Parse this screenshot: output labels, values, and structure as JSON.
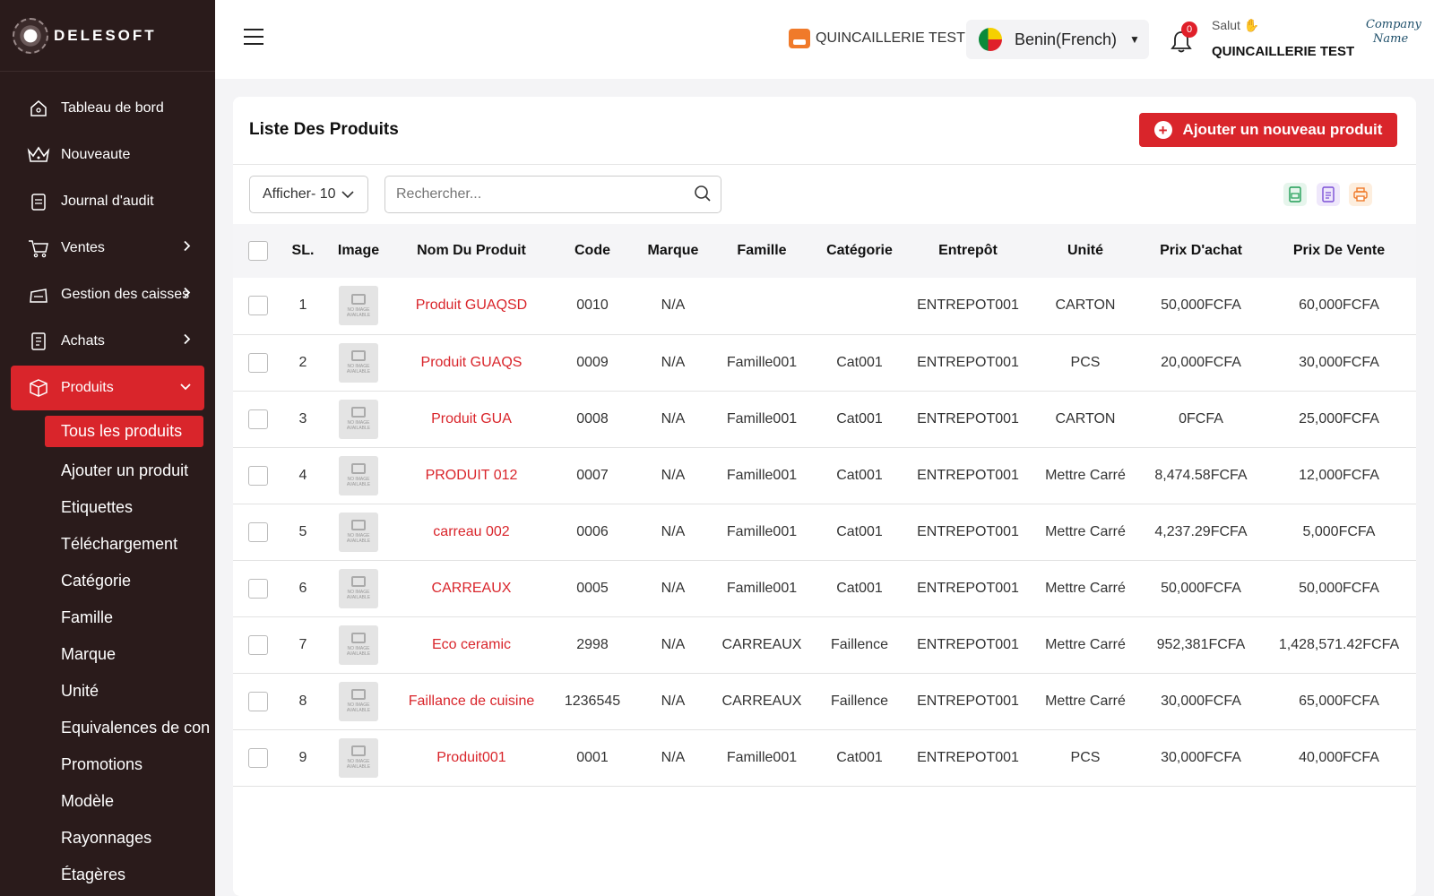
{
  "brand": {
    "name": "DELESOFT"
  },
  "sidebar": {
    "items": [
      {
        "label": "Tableau de bord",
        "icon": "home-icon",
        "chevron": false
      },
      {
        "label": "Nouveaute",
        "icon": "crown-icon",
        "chevron": false
      },
      {
        "label": "Journal d'audit",
        "icon": "clipboard-icon",
        "chevron": false
      },
      {
        "label": "Ventes",
        "icon": "cart-icon",
        "chevron": true
      },
      {
        "label": "Gestion des caisses",
        "icon": "cash-register-icon",
        "chevron": true
      },
      {
        "label": "Achats",
        "icon": "receipt-icon",
        "chevron": true
      },
      {
        "label": "Produits",
        "icon": "box-icon",
        "chevron": true,
        "active": true
      }
    ],
    "submenu": [
      "Tous les produits",
      "Ajouter un produit",
      "Etiquettes",
      "Téléchargement",
      "Catégorie",
      "Famille",
      "Marque",
      "Unité",
      "Equivalences de con",
      "Promotions",
      "Modèle",
      "Rayonnages",
      "Étagères"
    ]
  },
  "header": {
    "store": "QUINCAILLERIE TEST",
    "language": "Benin(French)",
    "notifications": "0",
    "greeting": "Salut",
    "user": "QUINCAILLERIE TEST",
    "company_logo": [
      "Company",
      "Name"
    ]
  },
  "page": {
    "title": "Liste Des Produits",
    "add_button": "Ajouter un nouveau produit",
    "show_label": "Afficher- 10",
    "search_placeholder": "Rechercher..."
  },
  "colors": {
    "accent": "#d9252b",
    "sidebar_bg": "#2a1b1b",
    "excel": "#1f9d55",
    "csv": "#7b4fd6",
    "print": "#f07a2a"
  },
  "table": {
    "columns": [
      "SL.",
      "Image",
      "Nom Du Produit",
      "Code",
      "Marque",
      "Famille",
      "Catégorie",
      "Entrepôt",
      "Unité",
      "Prix D'achat",
      "Prix De Vente"
    ],
    "no_image_text": [
      "NO IMAGE",
      "AVAILABLE"
    ],
    "rows": [
      {
        "sl": "1",
        "name": "Produit GUAQSD",
        "code": "0010",
        "marque": "N/A",
        "famille": "",
        "categorie": "",
        "entrepot": "ENTREPOT001",
        "unite": "CARTON",
        "achat": "50,000FCFA",
        "vente": "60,000FCFA"
      },
      {
        "sl": "2",
        "name": "Produit GUAQS",
        "code": "0009",
        "marque": "N/A",
        "famille": "Famille001",
        "categorie": "Cat001",
        "entrepot": "ENTREPOT001",
        "unite": "PCS",
        "achat": "20,000FCFA",
        "vente": "30,000FCFA"
      },
      {
        "sl": "3",
        "name": "Produit GUA",
        "code": "0008",
        "marque": "N/A",
        "famille": "Famille001",
        "categorie": "Cat001",
        "entrepot": "ENTREPOT001",
        "unite": "CARTON",
        "achat": "0FCFA",
        "vente": "25,000FCFA"
      },
      {
        "sl": "4",
        "name": "PRODUIT 012",
        "code": "0007",
        "marque": "N/A",
        "famille": "Famille001",
        "categorie": "Cat001",
        "entrepot": "ENTREPOT001",
        "unite": "Mettre Carré",
        "achat": "8,474.58FCFA",
        "vente": "12,000FCFA"
      },
      {
        "sl": "5",
        "name": "carreau 002",
        "code": "0006",
        "marque": "N/A",
        "famille": "Famille001",
        "categorie": "Cat001",
        "entrepot": "ENTREPOT001",
        "unite": "Mettre Carré",
        "achat": "4,237.29FCFA",
        "vente": "5,000FCFA"
      },
      {
        "sl": "6",
        "name": "CARREAUX",
        "code": "0005",
        "marque": "N/A",
        "famille": "Famille001",
        "categorie": "Cat001",
        "entrepot": "ENTREPOT001",
        "unite": "Mettre Carré",
        "achat": "50,000FCFA",
        "vente": "50,000FCFA"
      },
      {
        "sl": "7",
        "name": "Eco ceramic",
        "code": "2998",
        "marque": "N/A",
        "famille": "CARREAUX",
        "categorie": "Faillence",
        "entrepot": "ENTREPOT001",
        "unite": "Mettre Carré",
        "achat": "952,381FCFA",
        "vente": "1,428,571.42FCFA"
      },
      {
        "sl": "8",
        "name": "Faillance de cuisine",
        "code": "1236545",
        "marque": "N/A",
        "famille": "CARREAUX",
        "categorie": "Faillence",
        "entrepot": "ENTREPOT001",
        "unite": "Mettre Carré",
        "achat": "30,000FCFA",
        "vente": "65,000FCFA"
      },
      {
        "sl": "9",
        "name": "Produit001",
        "code": "0001",
        "marque": "N/A",
        "famille": "Famille001",
        "categorie": "Cat001",
        "entrepot": "ENTREPOT001",
        "unite": "PCS",
        "achat": "30,000FCFA",
        "vente": "40,000FCFA"
      }
    ]
  }
}
